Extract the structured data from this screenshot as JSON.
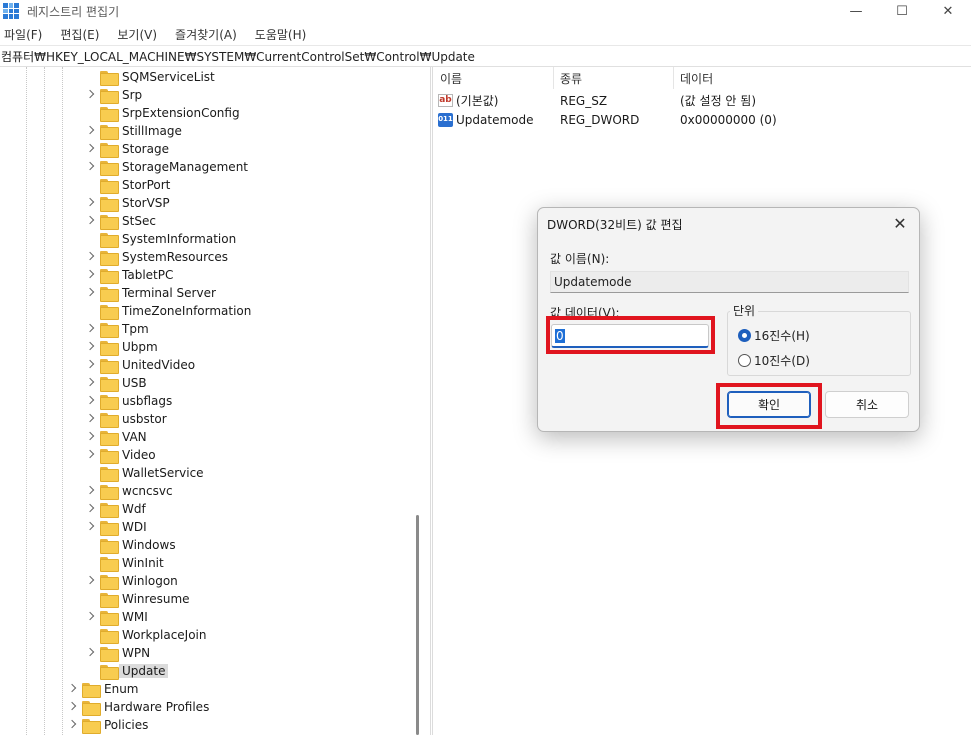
{
  "window": {
    "title": "레지스트리 편집기",
    "controls": {
      "minimize": "—",
      "maximize": "☐",
      "close": "✕"
    }
  },
  "menu": [
    "파일(F)",
    "편집(E)",
    "보기(V)",
    "즐겨찾기(A)",
    "도움말(H)"
  ],
  "address": "컴퓨터₩HKEY_LOCAL_MACHINE₩SYSTEM₩CurrentControlSet₩Control₩Update",
  "tree": {
    "control_children": [
      {
        "label": "SQMServiceList",
        "expandable": false
      },
      {
        "label": "Srp",
        "expandable": true
      },
      {
        "label": "SrpExtensionConfig",
        "expandable": false
      },
      {
        "label": "StillImage",
        "expandable": true
      },
      {
        "label": "Storage",
        "expandable": true
      },
      {
        "label": "StorageManagement",
        "expandable": true
      },
      {
        "label": "StorPort",
        "expandable": false
      },
      {
        "label": "StorVSP",
        "expandable": true
      },
      {
        "label": "StSec",
        "expandable": true
      },
      {
        "label": "SystemInformation",
        "expandable": false
      },
      {
        "label": "SystemResources",
        "expandable": true
      },
      {
        "label": "TabletPC",
        "expandable": true
      },
      {
        "label": "Terminal Server",
        "expandable": true
      },
      {
        "label": "TimeZoneInformation",
        "expandable": false
      },
      {
        "label": "Tpm",
        "expandable": true
      },
      {
        "label": "Ubpm",
        "expandable": true
      },
      {
        "label": "UnitedVideo",
        "expandable": true
      },
      {
        "label": "USB",
        "expandable": true
      },
      {
        "label": "usbflags",
        "expandable": true
      },
      {
        "label": "usbstor",
        "expandable": true
      },
      {
        "label": "VAN",
        "expandable": true
      },
      {
        "label": "Video",
        "expandable": true
      },
      {
        "label": "WalletService",
        "expandable": false
      },
      {
        "label": "wcncsvc",
        "expandable": true
      },
      {
        "label": "Wdf",
        "expandable": true
      },
      {
        "label": "WDI",
        "expandable": true
      },
      {
        "label": "Windows",
        "expandable": false
      },
      {
        "label": "WinInit",
        "expandable": false
      },
      {
        "label": "Winlogon",
        "expandable": true
      },
      {
        "label": "Winresume",
        "expandable": false
      },
      {
        "label": "WMI",
        "expandable": true
      },
      {
        "label": "WorkplaceJoin",
        "expandable": false
      },
      {
        "label": "WPN",
        "expandable": true
      },
      {
        "label": "Update",
        "expandable": false,
        "selected": true
      }
    ],
    "siblings": [
      {
        "label": "Enum",
        "expandable": true
      },
      {
        "label": "Hardware Profiles",
        "expandable": true
      },
      {
        "label": "Policies",
        "expandable": true
      }
    ]
  },
  "list": {
    "columns": [
      "이름",
      "종류",
      "데이터"
    ],
    "rows": [
      {
        "icon": "string-value-icon",
        "name": "(기본값)",
        "type": "REG_SZ",
        "data": "(값 설정 안 됨)"
      },
      {
        "icon": "dword-value-icon",
        "name": "Updatemode",
        "type": "REG_DWORD",
        "data": "0x00000000 (0)"
      }
    ]
  },
  "dialog": {
    "title": "DWORD(32비트) 값 편집",
    "name_label": "값 이름(N):",
    "name_value": "Updatemode",
    "data_label": "값 데이터(V):",
    "data_value": "0",
    "base_group_label": "단위",
    "radio_hex": "16진수(H)",
    "radio_dec": "10진수(D)",
    "ok_label": "확인",
    "cancel_label": "취소",
    "selected_base": "hex"
  },
  "colors": {
    "accent": "#1e5fbd",
    "highlight_box": "#e0141e",
    "folder": "#f8cc50"
  }
}
